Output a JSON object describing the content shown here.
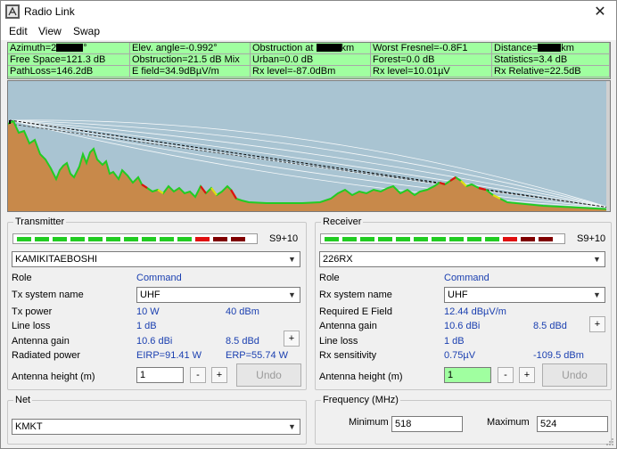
{
  "window": {
    "title": "Radio Link",
    "close_glyph": "✕",
    "app_icon": "radio-tower-icon"
  },
  "menu": [
    "Edit",
    "View",
    "Swap"
  ],
  "info": {
    "row1": [
      {
        "pre": "Azimuth=2",
        "mask": true,
        "post": "°"
      },
      {
        "pre": "Elev. angle=-0.992°",
        "mask": false,
        "post": ""
      },
      {
        "pre": "Obstruction at ",
        "mask": true,
        "post": "km"
      },
      {
        "pre": "Worst Fresnel=-0.8F1",
        "mask": false,
        "post": ""
      },
      {
        "pre": "Distance=",
        "mask": true,
        "post": "km"
      }
    ],
    "row2": [
      "Free Space=121.3 dB",
      "Obstruction=21.5 dB Mix",
      "Urban=0.0 dB",
      "Forest=0.0 dB",
      "Statistics=3.4 dB"
    ],
    "row3": [
      "PathLoss=146.2dB",
      "E field=34.9dBµV/m",
      "Rx level=-87.0dBm",
      "Rx level=10.01µV",
      "Rx Relative=22.5dB"
    ]
  },
  "transmitter": {
    "title": "Transmitter",
    "meter_label": "S9+10",
    "site": "KAMIKITAEBOSHI",
    "role_label": "Role",
    "role_value": "Command",
    "system_label": "Tx system name",
    "system_value": "UHF",
    "power_label": "Tx power",
    "power_w": "10 W",
    "power_dbm": "40 dBm",
    "loss_label": "Line loss",
    "loss_value": "1 dB",
    "gain_label": "Antenna gain",
    "gain_dbi": "10.6 dBi",
    "gain_dbd": "8.5 dBd",
    "radiated_label": "Radiated power",
    "eirp": "EIRP=91.41 W",
    "erp": "ERP=55.74 W",
    "height_label": "Antenna height (m)",
    "height_value": "1",
    "minus": "-",
    "plus": "+",
    "undo": "Undo"
  },
  "receiver": {
    "title": "Receiver",
    "meter_label": "S9+10",
    "site": "226RX",
    "role_label": "Role",
    "role_value": "Command",
    "system_label": "Rx system name",
    "system_value": "UHF",
    "field_label": "Required E Field",
    "field_value": "12.44 dBµV/m",
    "gain_label": "Antenna gain",
    "gain_dbi": "10.6 dBi",
    "gain_dbd": "8.5 dBd",
    "loss_label": "Line loss",
    "loss_value": "1 dB",
    "sens_label": "Rx sensitivity",
    "sens_uv": "0.75µV",
    "sens_dbm": "-109.5 dBm",
    "height_label": "Antenna height (m)",
    "height_value": "1",
    "minus": "-",
    "plus": "+",
    "undo": "Undo"
  },
  "net": {
    "title": "Net",
    "value": "KMKT"
  },
  "frequency": {
    "title": "Frequency (MHz)",
    "min_label": "Minimum",
    "min_value": "518",
    "max_label": "Maximum",
    "max_value": "524"
  },
  "colors": {
    "info_bg": "#a0ffa0",
    "profile_sky": "#a9c4d2",
    "terrain": "#c8894a",
    "terrain_edge": "#22cc22",
    "meter_green": "#22cc22",
    "meter_red": "#e01010",
    "meter_darkred": "#800000",
    "value_blue": "#1a3fb0"
  },
  "meter_levels": {
    "green_segments": 10,
    "red_segments": 1,
    "darkred_segments": 2
  }
}
